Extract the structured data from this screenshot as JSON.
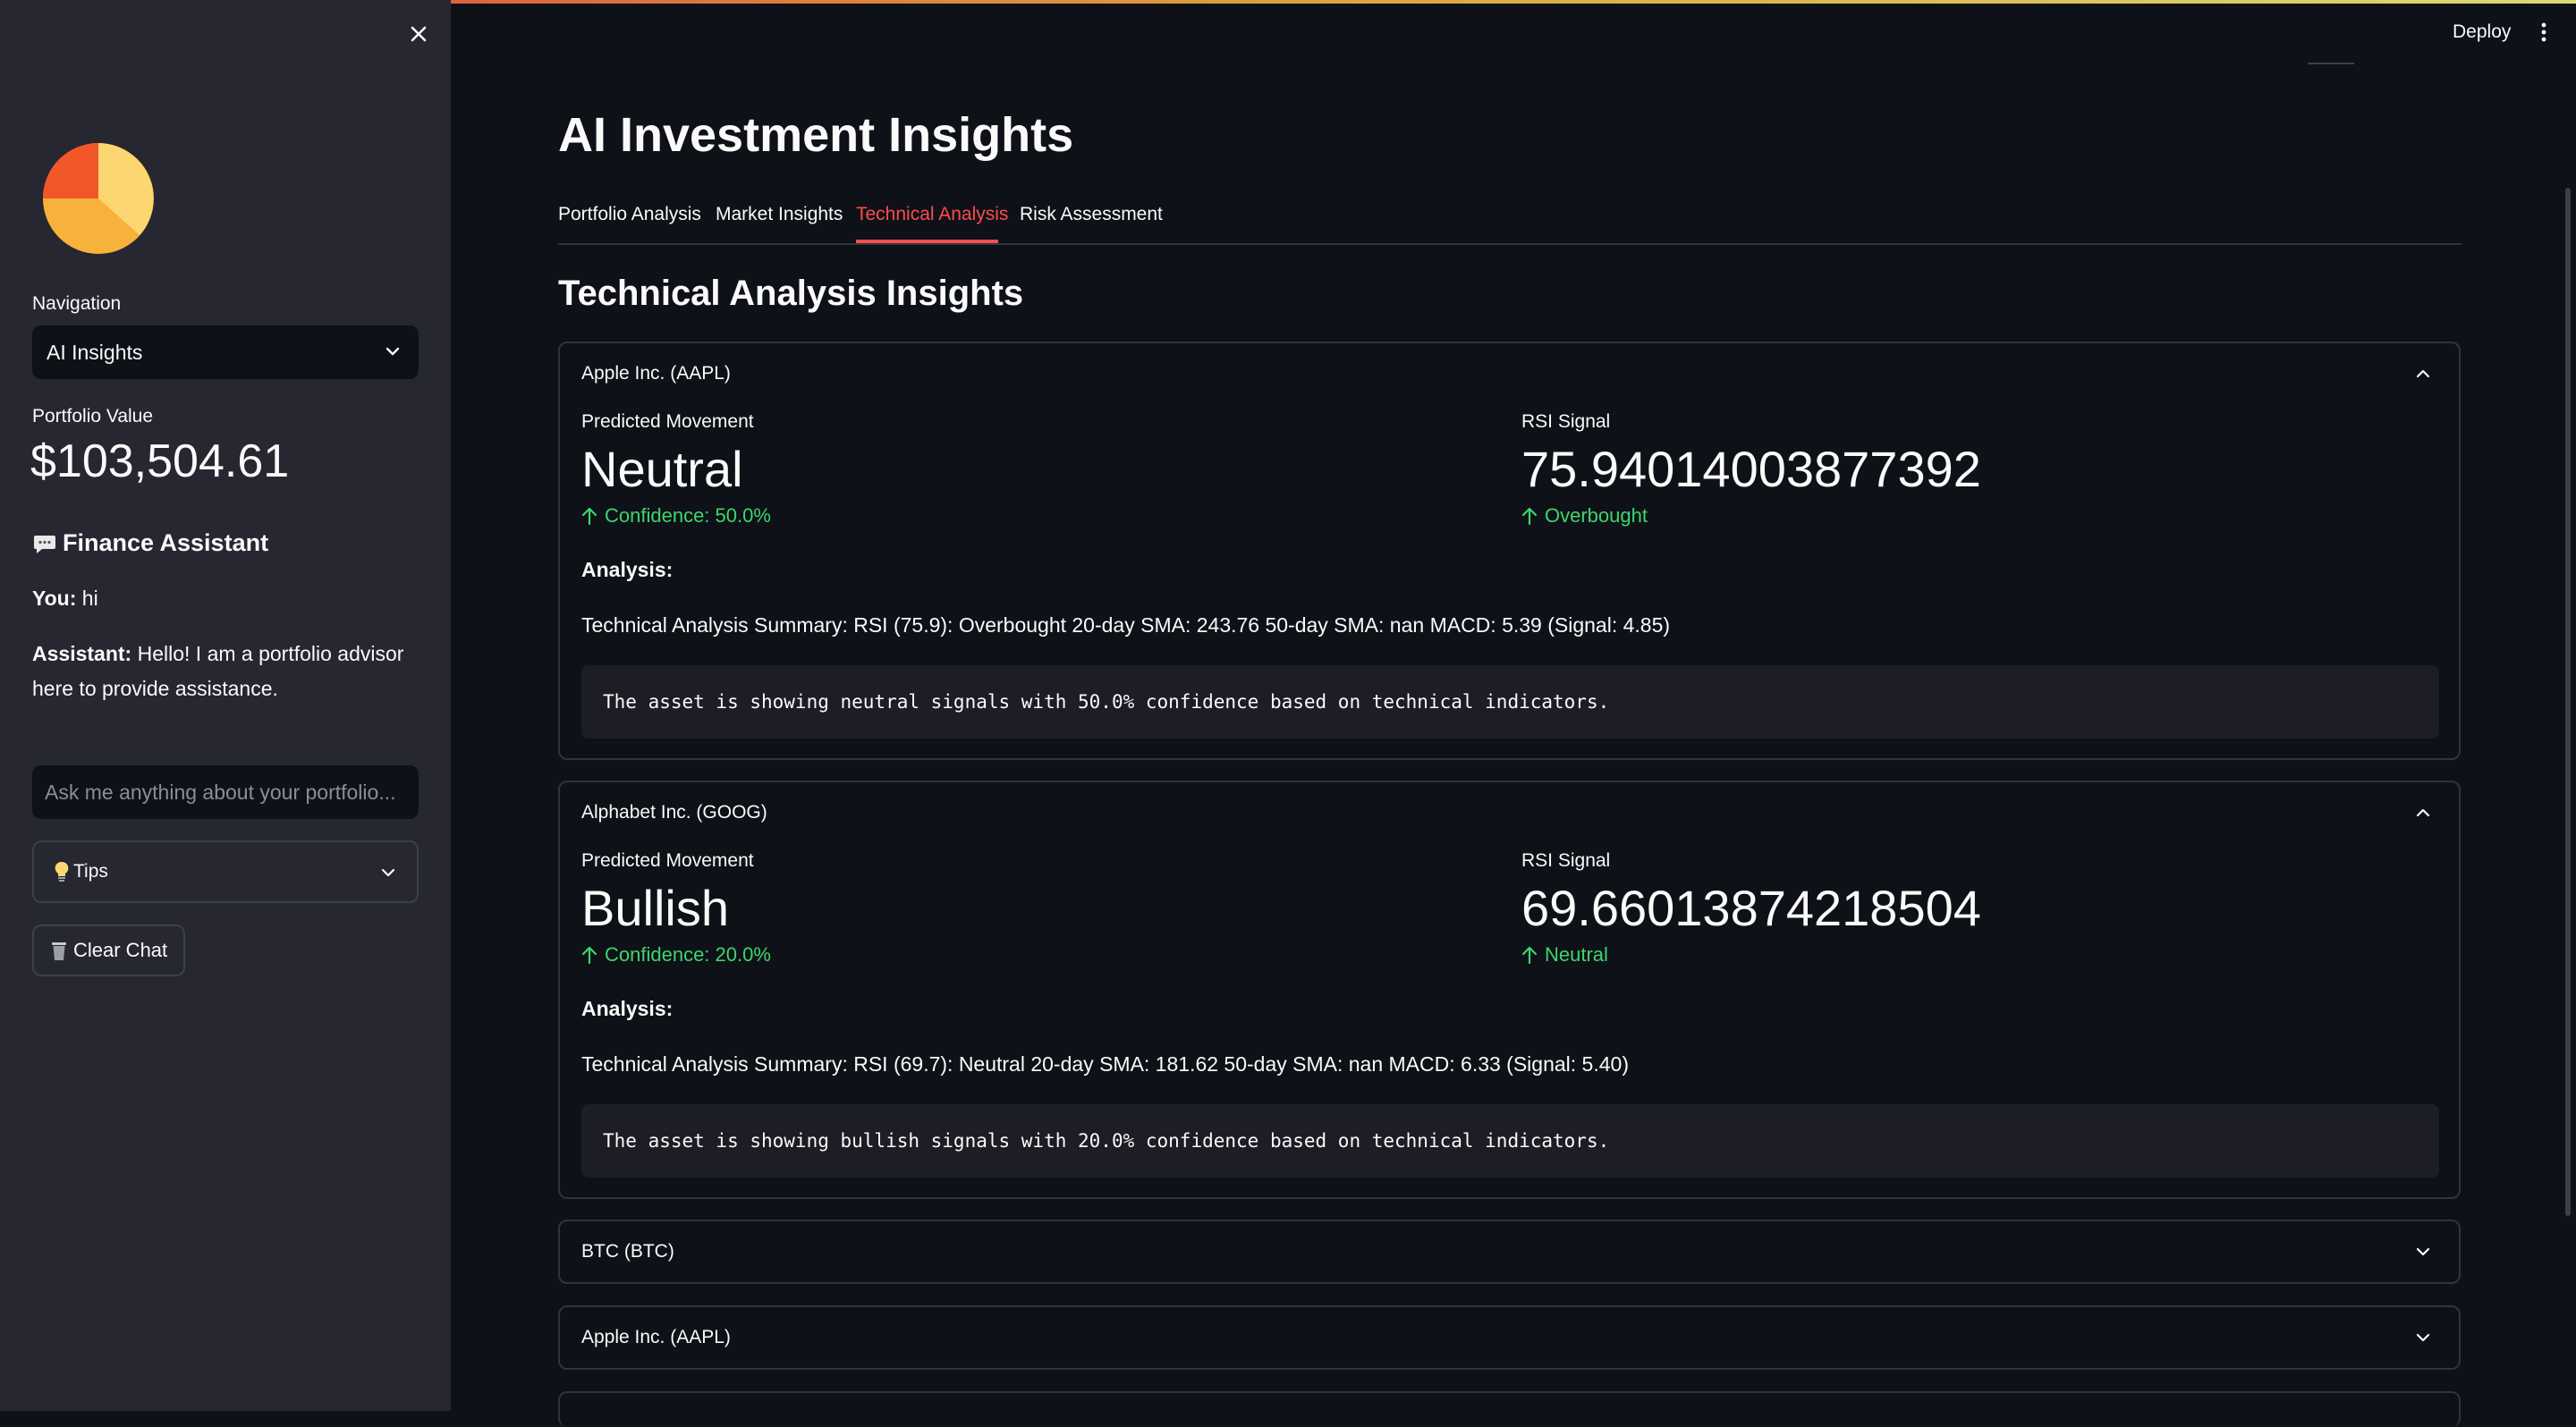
{
  "sidebar": {
    "navigation_label": "Navigation",
    "navigation_selected": "AI Insights",
    "portfolio_label": "Portfolio Value",
    "portfolio_value": "$103,504.61",
    "assistant_title": "Finance Assistant",
    "assistant_icon": "speech-bubble-icon",
    "chat": [
      {
        "speaker": "You:",
        "text": " hi"
      },
      {
        "speaker": "Assistant:",
        "text": " Hello! I am a portfolio advisor here to provide assistance."
      }
    ],
    "chat_placeholder": "Ask me anything about your portfolio...",
    "tips_label": "Tips",
    "clear_label": "Clear Chat"
  },
  "header": {
    "deploy_label": "Deploy"
  },
  "main": {
    "title": "AI Investment Insights",
    "tabs": [
      {
        "label": "Portfolio Analysis"
      },
      {
        "label": "Market Insights"
      },
      {
        "label": "Technical Analysis"
      },
      {
        "label": "Risk Assessment"
      }
    ],
    "active_tab": "Technical Analysis",
    "section_title": "Technical Analysis Insights",
    "cards": [
      {
        "name": "Apple Inc. (AAPL)",
        "expanded": true,
        "movement_label": "Predicted Movement",
        "movement": "Neutral",
        "movement_delta": "Confidence: 50.0%",
        "rsi_label": "RSI Signal",
        "rsi": "75.94014003877392",
        "rsi_delta": "Overbought",
        "analysis_label": "Analysis:",
        "summary": "Technical Analysis Summary: RSI (75.9): Overbought 20-day SMA: 243.76 50-day SMA: nan MACD: 5.39 (Signal: 4.85)",
        "note": "The asset is showing neutral signals with 50.0% confidence based on technical indicators."
      },
      {
        "name": "Alphabet Inc. (GOOG)",
        "expanded": true,
        "movement_label": "Predicted Movement",
        "movement": "Bullish",
        "movement_delta": "Confidence: 20.0%",
        "rsi_label": "RSI Signal",
        "rsi": "69.66013874218504",
        "rsi_delta": "Neutral",
        "analysis_label": "Analysis:",
        "summary": "Technical Analysis Summary: RSI (69.7): Neutral 20-day SMA: 181.62 50-day SMA: nan MACD: 6.33 (Signal: 5.40)",
        "note": "The asset is showing bullish signals with 20.0% confidence based on technical indicators."
      },
      {
        "name": "BTC (BTC)",
        "expanded": false
      },
      {
        "name": "Apple Inc. (AAPL)",
        "expanded": false
      }
    ]
  },
  "colors": {
    "background": "#0e1117",
    "sidebar": "#262730",
    "accent": "#ff4b4b",
    "positive": "#3dd56d"
  }
}
